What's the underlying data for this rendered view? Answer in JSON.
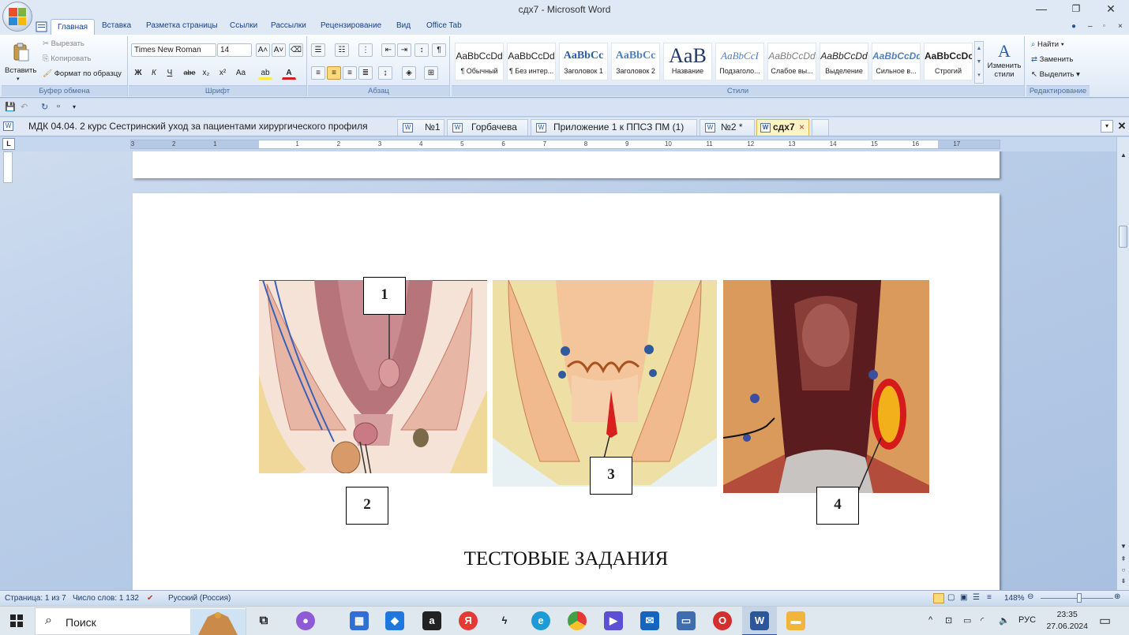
{
  "window": {
    "title": "сдх7 - Microsoft Word",
    "minimize": "—",
    "restore": "❐",
    "close": "✕"
  },
  "ribbon_tabs": [
    "Главная",
    "Вставка",
    "Разметка страницы",
    "Ссылки",
    "Рассылки",
    "Рецензирование",
    "Вид",
    "Office Tab"
  ],
  "clipboard": {
    "paste": "Вставить",
    "cut": "Вырезать",
    "copy": "Копировать",
    "format_painter": "Формат по образцу",
    "label": "Буфер обмена"
  },
  "font": {
    "name": "Times New Roman",
    "size": "14",
    "label": "Шрифт",
    "bold": "Ж",
    "italic": "К",
    "underline": "Ч",
    "strike": "abe",
    "subscript": "x₂",
    "superscript": "x²",
    "change_case": "Aa",
    "grow": "A˄",
    "shrink": "A˅"
  },
  "paragraph": {
    "label": "Абзац",
    "pilcrow": "¶"
  },
  "styles": {
    "label": "Стили",
    "items": [
      {
        "sample": "AaBbCcDd",
        "name": "¶ Обычный"
      },
      {
        "sample": "AaBbCcDd",
        "name": "¶ Без интер..."
      },
      {
        "sample": "AaBbCc",
        "name": "Заголовок 1"
      },
      {
        "sample": "AaBbCc",
        "name": "Заголовок 2"
      },
      {
        "sample": "AaB",
        "name": "Название"
      },
      {
        "sample": "AaBbCcI",
        "name": "Подзаголо..."
      },
      {
        "sample": "AaBbCcDd",
        "name": "Слабое вы..."
      },
      {
        "sample": "AaBbCcDd",
        "name": "Выделение"
      },
      {
        "sample": "AaBbCcDd",
        "name": "Сильное в..."
      },
      {
        "sample": "AaBbCcDc",
        "name": "Строгий"
      }
    ],
    "change_styles": "Изменить стили"
  },
  "editing": {
    "label": "Редактирование",
    "find": "Найти",
    "replace": "Заменить",
    "select": "Выделить"
  },
  "doc_tabs": [
    "МДК 04.04.  2 курс Сестринский уход за пациентами хирургического профиля",
    "№1",
    "Горбачева",
    "Приложение 1 к ППСЗ ПМ (1)",
    "№2 *",
    "сдх7"
  ],
  "ruler": {
    "button": "L",
    "numbers": [
      "3",
      "2",
      "1",
      "1",
      "2",
      "3",
      "4",
      "5",
      "6",
      "7",
      "8",
      "9",
      "10",
      "11",
      "12",
      "13",
      "14",
      "15",
      "16",
      "17"
    ]
  },
  "document": {
    "labels": [
      "1",
      "2",
      "3",
      "4"
    ],
    "heading": "ТЕСТОВЫЕ ЗАДАНИЯ"
  },
  "status": {
    "page": "Страница: 1 из 7",
    "words": "Число слов: 1 132",
    "language": "Русский (Россия)",
    "zoom": "148%"
  },
  "taskbar": {
    "search": "Поиск",
    "lang": "РУС",
    "time": "23:35",
    "date": "27.06.2024"
  },
  "colors": {
    "word_blue": "#2b579a",
    "ribbon_label": "#4a6fa5",
    "active_doc_tab": "#fff3c4"
  }
}
